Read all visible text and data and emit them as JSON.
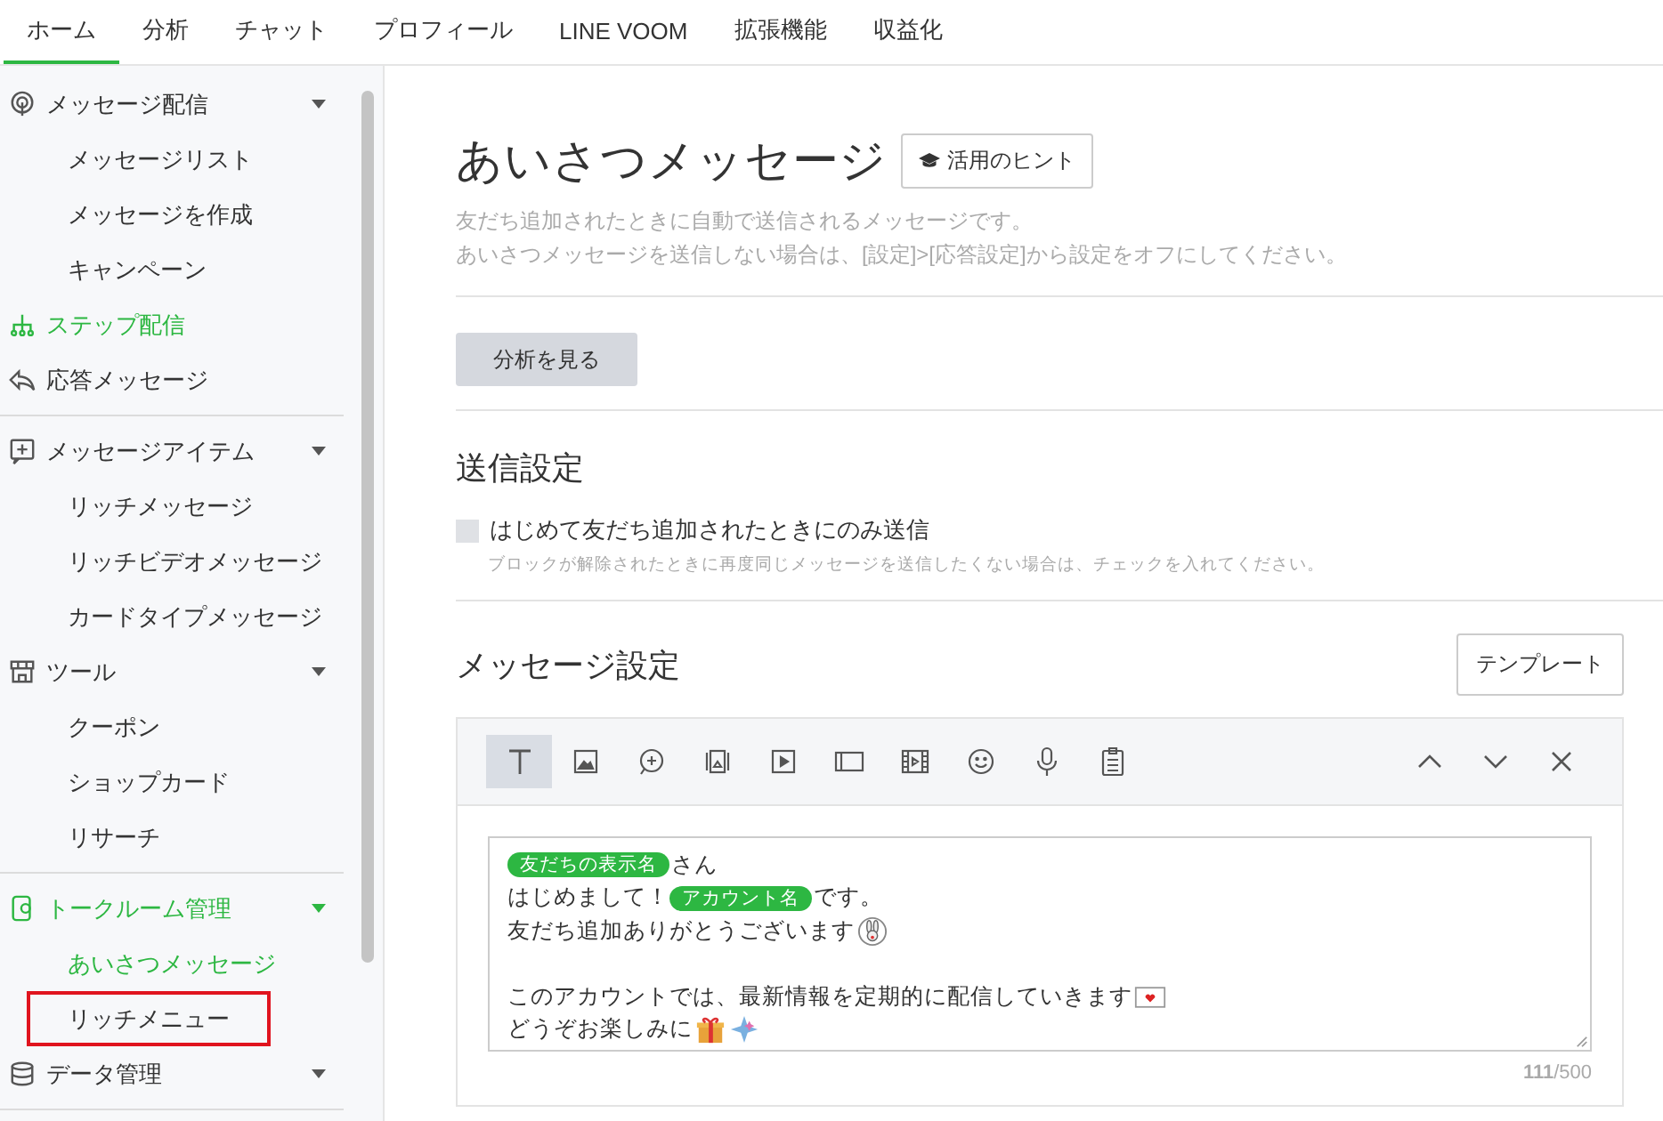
{
  "top_tabs": [
    {
      "label": "ホーム",
      "selected": true
    },
    {
      "label": "分析",
      "selected": false
    },
    {
      "label": "チャット",
      "selected": false
    },
    {
      "label": "プロフィール",
      "selected": false
    },
    {
      "label": "LINE VOOM",
      "selected": false
    },
    {
      "label": "拡張機能",
      "selected": false
    },
    {
      "label": "収益化",
      "selected": false
    }
  ],
  "sidebar": {
    "sections": [
      {
        "items": [
          {
            "kind": "broadcast",
            "label": "メッセージ配信",
            "active": false,
            "expanded": true,
            "children": [
              {
                "label": "メッセージリスト",
                "selected": false,
                "highlighted": false
              },
              {
                "label": "メッセージを作成",
                "selected": false,
                "highlighted": false
              },
              {
                "label": "キャンペーン",
                "selected": false,
                "highlighted": false
              }
            ]
          },
          {
            "kind": "step",
            "label": "ステップ配信",
            "active": true
          },
          {
            "kind": "reply",
            "label": "応答メッセージ",
            "active": false
          }
        ]
      },
      {
        "items": [
          {
            "kind": "item",
            "label": "メッセージアイテム",
            "active": false,
            "expanded": true,
            "children": [
              {
                "label": "リッチメッセージ",
                "selected": false,
                "highlighted": false
              },
              {
                "label": "リッチビデオメッセージ",
                "selected": false,
                "highlighted": false
              },
              {
                "label": "カードタイプメッセージ",
                "selected": false,
                "highlighted": false
              }
            ]
          },
          {
            "kind": "store",
            "label": "ツール",
            "active": false,
            "expanded": true,
            "children": [
              {
                "label": "クーポン",
                "selected": false,
                "highlighted": false
              },
              {
                "label": "ショップカード",
                "selected": false,
                "highlighted": false
              },
              {
                "label": "リサーチ",
                "selected": false,
                "highlighted": false
              }
            ]
          }
        ]
      },
      {
        "items": [
          {
            "kind": "talkroom",
            "label": "トークルーム管理",
            "active": true,
            "expanded": true,
            "children": [
              {
                "label": "あいさつメッセージ",
                "selected": true,
                "highlighted": false
              },
              {
                "label": "リッチメニュー",
                "selected": false,
                "highlighted": true
              }
            ]
          },
          {
            "kind": "database",
            "label": "データ管理",
            "active": false,
            "expanded": true
          }
        ]
      }
    ]
  },
  "page": {
    "title": "あいさつメッセージ",
    "hint_button": "活用のヒント",
    "description": [
      "友だち追加されたときに自動で送信されるメッセージです。",
      "あいさつメッセージを送信しない場合は、[設定]>[応答設定]から設定をオフにしてください。"
    ],
    "analysis_button": "分析を見る",
    "send_settings": {
      "heading": "送信設定",
      "checkbox": {
        "label": "はじめて友だち追加されたときにのみ送信",
        "checked": false
      },
      "note": "ブロックが解除されたときに再度同じメッセージを送信したくない場合は、チェックを入れてください。"
    },
    "message_settings": {
      "heading": "メッセージ設定",
      "template_button": "テンプレート",
      "tools": [
        {
          "kind": "text",
          "selected": true
        },
        {
          "kind": "image",
          "selected": false
        },
        {
          "kind": "bubble",
          "selected": false
        },
        {
          "kind": "carousel",
          "selected": false
        },
        {
          "kind": "video",
          "selected": false
        },
        {
          "kind": "card",
          "selected": false
        },
        {
          "kind": "film",
          "selected": false
        },
        {
          "kind": "smile",
          "selected": false
        },
        {
          "kind": "mic",
          "selected": false
        },
        {
          "kind": "survey",
          "selected": false
        }
      ],
      "controls": [
        {
          "kind": "up"
        },
        {
          "kind": "down"
        },
        {
          "kind": "close"
        }
      ],
      "message_lines": [
        {
          "segments": [
            {
              "kind": "tag",
              "text": "友だちの表示名"
            },
            {
              "kind": "text",
              "text": "さん"
            }
          ]
        },
        {
          "segments": [
            {
              "kind": "text",
              "text": "はじめまして！"
            },
            {
              "kind": "tag",
              "text": "アカウント名"
            },
            {
              "kind": "text",
              "text": "です。"
            }
          ]
        },
        {
          "segments": [
            {
              "kind": "text",
              "text": "友だち追加ありがとうございます"
            },
            {
              "kind": "rabbit"
            }
          ]
        },
        {
          "blank_line_before": true,
          "segments": [
            {
              "kind": "text",
              "text": "このアカウントでは、最新情報を定期的に配信していきます"
            },
            {
              "kind": "envelope"
            }
          ]
        },
        {
          "segments": [
            {
              "kind": "text",
              "text": "どうぞお楽しみに"
            },
            {
              "kind": "gift"
            },
            {
              "kind": "sparkle"
            }
          ]
        }
      ],
      "counter": "**111**/500"
    }
  }
}
